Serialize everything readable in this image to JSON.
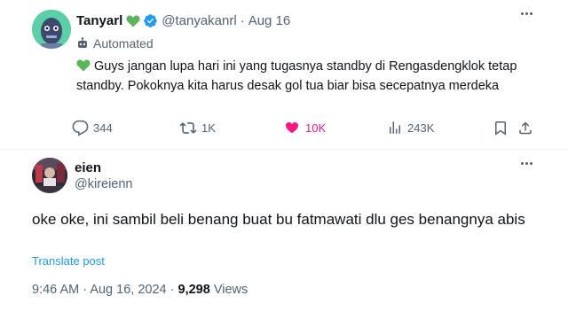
{
  "tweet": {
    "author_name": "Tanyarl",
    "handle": "@tanyakanrl",
    "separator": "·",
    "date": "Aug 16",
    "automated_label": "Automated",
    "text": "Guys jangan lupa hari ini yang tugasnya standby di Rengasdengklok tetap standby. Pokoknya kita harus desak gol tua biar bisa secepatnya merdeka",
    "stats": {
      "replies": "344",
      "reposts": "1K",
      "likes": "10K",
      "views": "243K"
    },
    "colors": {
      "like": "#f91880",
      "verified": "#1d9bf0",
      "green_heart": "#5bb55a"
    }
  },
  "reply": {
    "author_name": "eien",
    "handle": "@kireienn",
    "text": "oke oke, ini sambil beli benang buat bu fatmawati dlu ges benangnya abis",
    "translate_label": "Translate post",
    "time": "9:46 AM",
    "separator1": "·",
    "date": "Aug 16, 2024",
    "separator2": "·",
    "views_count": "9,298",
    "views_label": "Views"
  }
}
